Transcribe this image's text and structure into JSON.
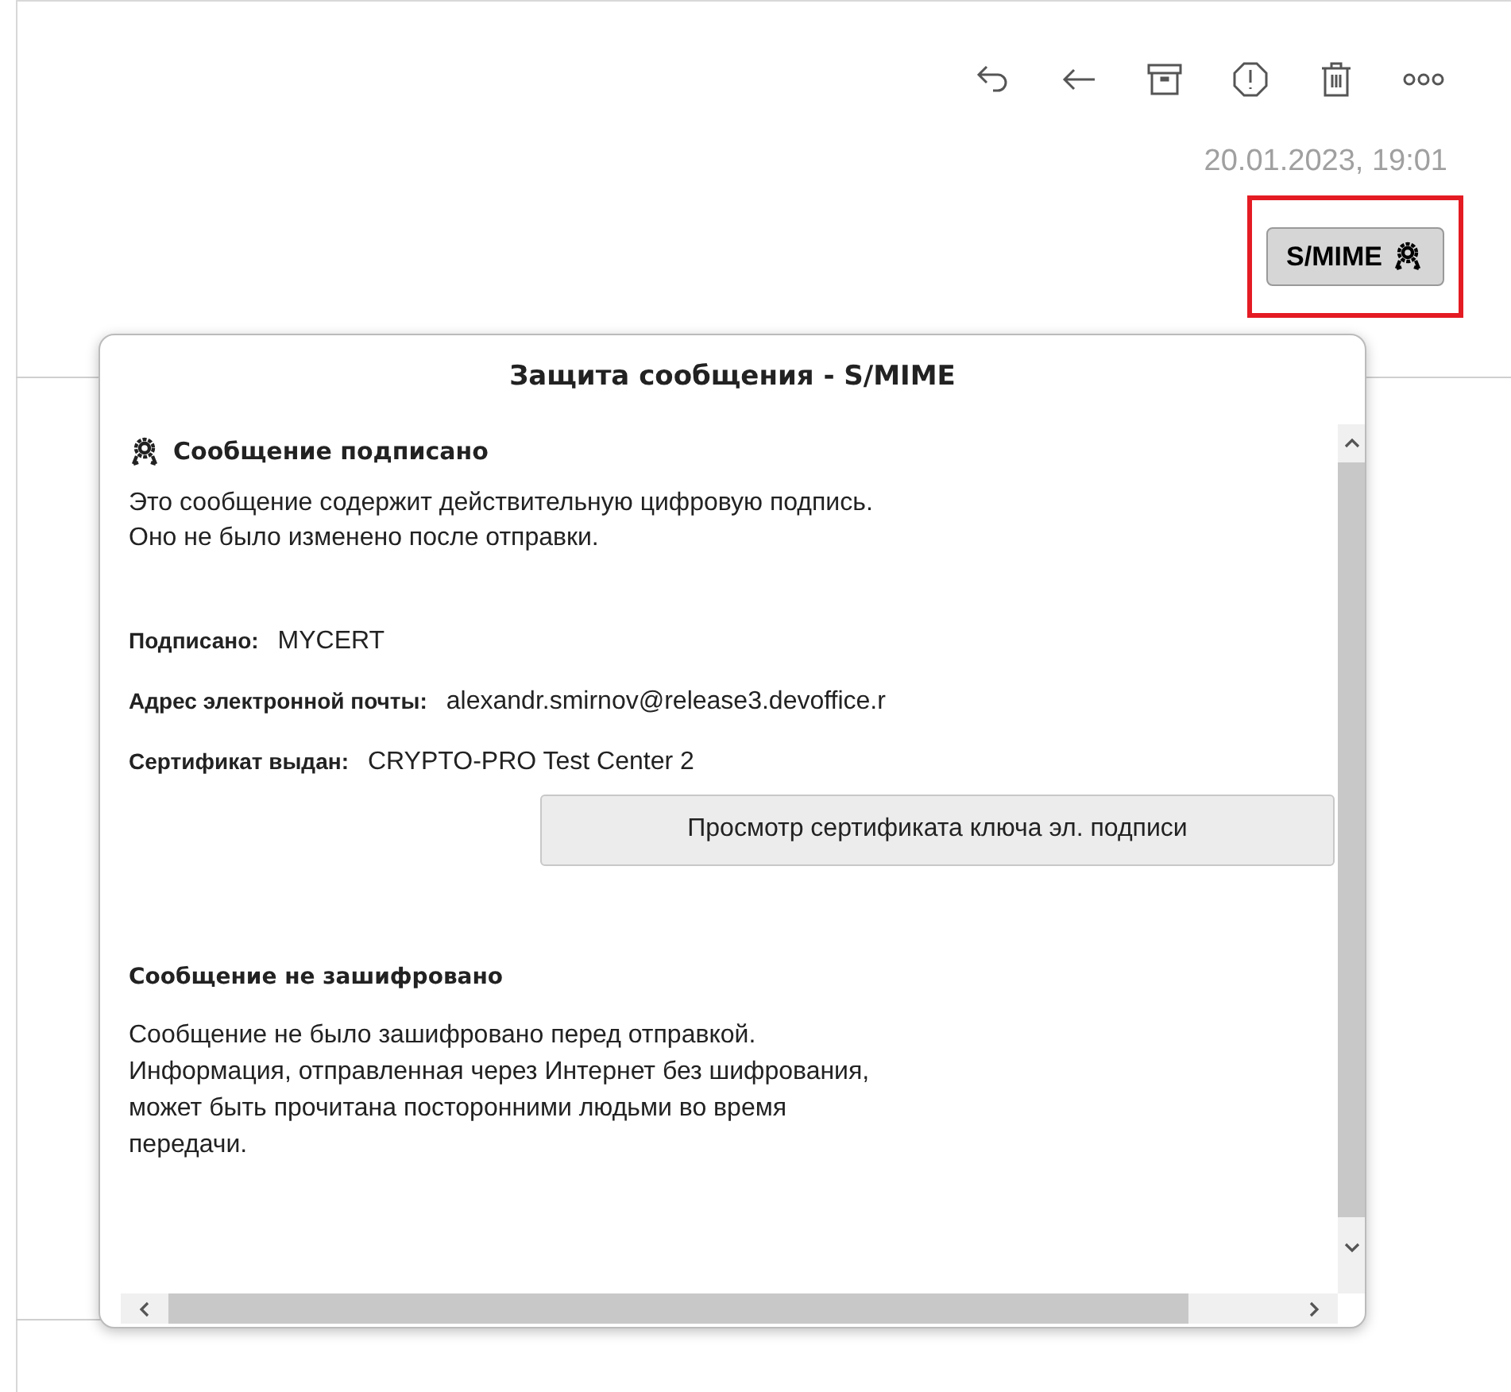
{
  "message_header": {
    "date": "20.01.2023, 19:01",
    "smime_button": "S/MIME"
  },
  "popup": {
    "title": "Защита сообщения - S/MIME",
    "signature": {
      "heading": "Сообщение подписано",
      "text": "Это сообщение содержит действительную цифровую подпись.\nОно не было изменено после отправки.",
      "fields": [
        {
          "label": "Подписано:",
          "value": "MYCERT"
        },
        {
          "label": "Адрес электронной почты:",
          "value": "alexandr.smirnov@release3.devoffice.r"
        },
        {
          "label": "Сертификат выдан:",
          "value": "CRYPTO-PRO Test Center 2"
        }
      ],
      "view_button": "Просмотр сертификата ключа эл. подписи"
    },
    "encryption": {
      "heading": "Сообщение не зашифровано",
      "text": "Сообщение не было зашифровано перед отправкой.\nИнформация, отправленная через Интернет без шифрования,\nможет быть прочитана посторонними людьми во время\nпередачи."
    }
  }
}
